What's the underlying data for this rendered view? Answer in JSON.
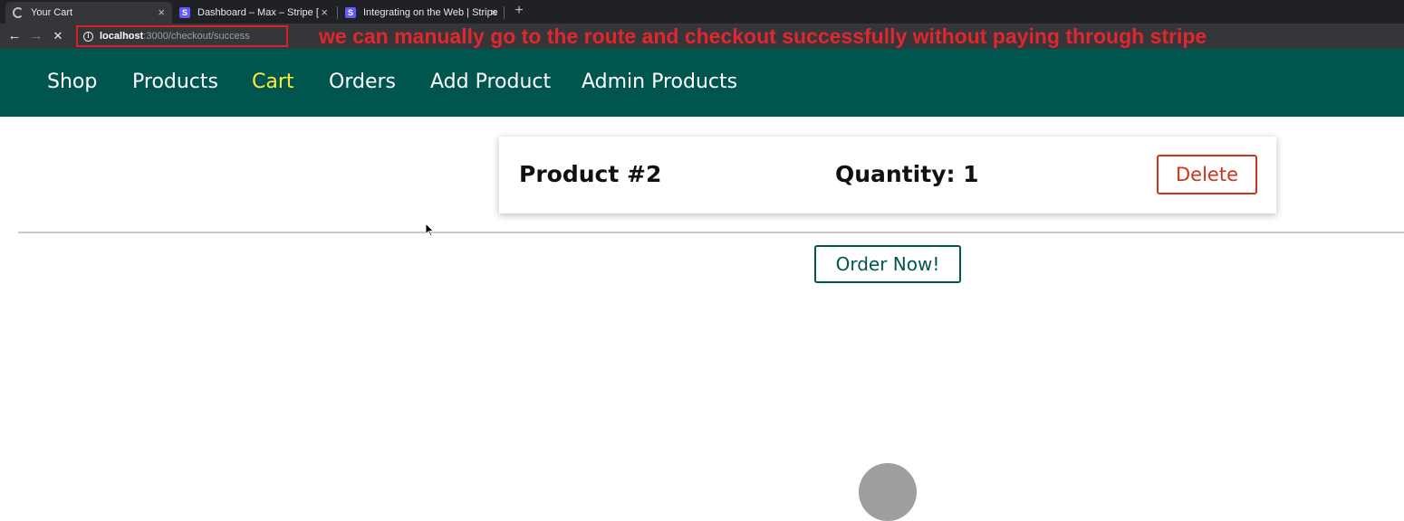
{
  "browser": {
    "tabs": [
      {
        "title": "Your Cart",
        "favicon": "loading-spinner-icon",
        "close": "×"
      },
      {
        "title": "Dashboard – Max – Stripe [Test]",
        "favicon": "stripe-icon",
        "close": "×"
      },
      {
        "title": "Integrating on the Web | Stripe",
        "favicon": "stripe-icon",
        "close": "×"
      }
    ],
    "favicon_letter": "S",
    "new_tab": "+",
    "back": "←",
    "forward": "→",
    "stop": "✕",
    "info": "i",
    "url_host": "localhost",
    "url_path": ":3000/checkout/success"
  },
  "annotation": "we can manually go to the route and checkout successfully without paying through stripe",
  "nav": {
    "items": [
      {
        "label": "Shop",
        "active": false
      },
      {
        "label": "Products",
        "active": false
      },
      {
        "label": "Cart",
        "active": true
      },
      {
        "label": "Orders",
        "active": false
      },
      {
        "label": "Add Product",
        "active": false
      },
      {
        "label": "Admin Products",
        "active": false
      }
    ]
  },
  "cart": {
    "items": [
      {
        "title": "Product #2",
        "quantity": "Quantity: 1",
        "delete_label": "Delete"
      }
    ],
    "order_button": "Order Now!"
  },
  "colors": {
    "header_bg": "#00564f",
    "active_nav": "#ffeb3b",
    "delete": "#d2331d",
    "annotation": "#e0262e"
  }
}
